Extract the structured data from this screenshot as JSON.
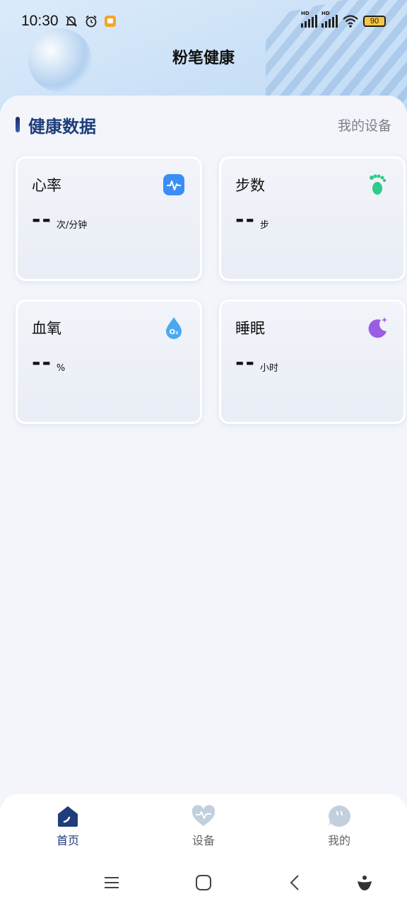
{
  "status_bar": {
    "time": "10:30",
    "battery": "90"
  },
  "header": {
    "title": "粉笔健康"
  },
  "section": {
    "title": "健康数据",
    "link": "我的设备"
  },
  "cards": [
    {
      "title": "心率",
      "value": "--",
      "unit": "次/分钟",
      "icon": "heart-rate-icon",
      "color": "#3b8ef5"
    },
    {
      "title": "步数",
      "value": "--",
      "unit": "步",
      "icon": "footprint-icon",
      "color": "#2ecc8a"
    },
    {
      "title": "血氧",
      "value": "--",
      "unit": "%",
      "icon": "oxygen-drop-icon",
      "color": "#4aa8f0"
    },
    {
      "title": "睡眠",
      "value": "--",
      "unit": "小时",
      "icon": "moon-icon",
      "color": "#9b5de5"
    }
  ],
  "tabs": [
    {
      "label": "首页",
      "icon": "home-icon",
      "active": true
    },
    {
      "label": "设备",
      "icon": "device-heart-icon",
      "active": false
    },
    {
      "label": "我的",
      "icon": "profile-bubble-icon",
      "active": false
    }
  ],
  "nav": [
    "menu-icon",
    "home-square-icon",
    "back-icon",
    "assistant-icon"
  ],
  "colors": {
    "accent": "#1f3d7a",
    "background": "#f3f5fa"
  }
}
